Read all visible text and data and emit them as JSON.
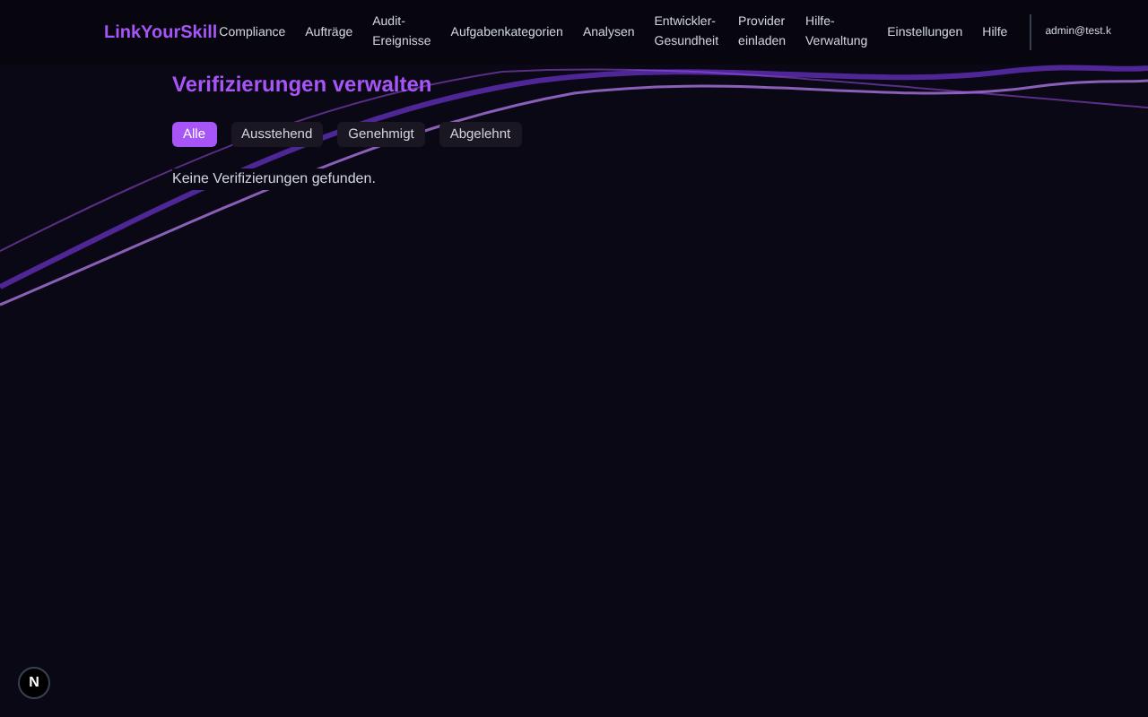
{
  "brand": "LinkYourSkill",
  "nav": [
    {
      "label": "Compliance"
    },
    {
      "label": "Aufträge"
    },
    {
      "label": "Audit-Ereignisse"
    },
    {
      "label": "Aufgabenkategorien"
    },
    {
      "label": "Analysen"
    },
    {
      "label": "Entwickler-Gesundheit"
    },
    {
      "label": "Provider einladen"
    },
    {
      "label": "Hilfe-Verwaltung"
    },
    {
      "label": "Einstellungen"
    },
    {
      "label": "Hilfe"
    }
  ],
  "user": "admin@test.k",
  "title": "Verifizierungen verwalten",
  "tabs": [
    {
      "label": "Alle",
      "selected": true
    },
    {
      "label": "Ausstehend",
      "selected": false
    },
    {
      "label": "Genehmigt",
      "selected": false
    },
    {
      "label": "Abgelehnt",
      "selected": false
    }
  ],
  "empty_message": "Keine Verifizierungen gefunden.",
  "dev_badge": "N"
}
